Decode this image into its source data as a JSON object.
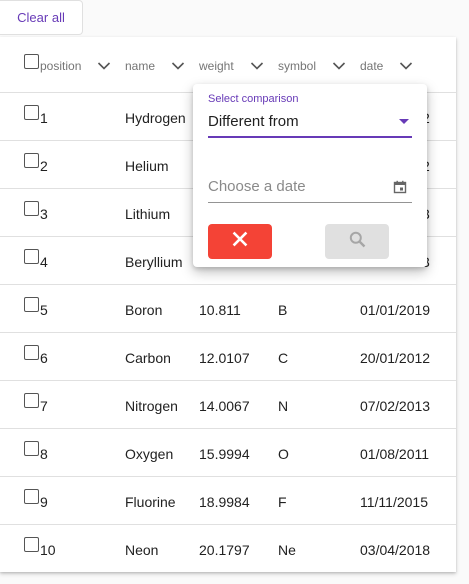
{
  "toolbar": {
    "clear_all_label": "Clear all"
  },
  "table": {
    "columns": [
      {
        "key": "position",
        "label": "position"
      },
      {
        "key": "name",
        "label": "name"
      },
      {
        "key": "weight",
        "label": "weight"
      },
      {
        "key": "symbol",
        "label": "symbol"
      },
      {
        "key": "date",
        "label": "date"
      }
    ],
    "rows": [
      {
        "position": "1",
        "name": "Hydrogen",
        "weight": "",
        "symbol": "",
        "date": "2"
      },
      {
        "position": "2",
        "name": "Helium",
        "weight": "",
        "symbol": "",
        "date": "2"
      },
      {
        "position": "3",
        "name": "Lithium",
        "weight": "",
        "symbol": "",
        "date": "3"
      },
      {
        "position": "4",
        "name": "Beryllium",
        "weight": "",
        "symbol": "",
        "date": "3"
      },
      {
        "position": "5",
        "name": "Boron",
        "weight": "10.811",
        "symbol": "B",
        "date": "01/01/2019"
      },
      {
        "position": "6",
        "name": "Carbon",
        "weight": "12.0107",
        "symbol": "C",
        "date": "20/01/2012"
      },
      {
        "position": "7",
        "name": "Nitrogen",
        "weight": "14.0067",
        "symbol": "N",
        "date": "07/02/2013"
      },
      {
        "position": "8",
        "name": "Oxygen",
        "weight": "15.9994",
        "symbol": "O",
        "date": "01/08/2011"
      },
      {
        "position": "9",
        "name": "Fluorine",
        "weight": "18.9984",
        "symbol": "F",
        "date": "11/11/2015"
      },
      {
        "position": "10",
        "name": "Neon",
        "weight": "20.1797",
        "symbol": "Ne",
        "date": "03/04/2018"
      }
    ]
  },
  "filter_popup": {
    "select_label": "Select comparison",
    "select_value": "Different from",
    "date_placeholder": "Choose a date",
    "icons": {
      "calendar": "calendar-icon",
      "cancel": "close-icon",
      "search": "search-icon"
    }
  },
  "colors": {
    "accent": "#673ab7",
    "danger": "#f44336",
    "disabled": "#e0e0e0"
  }
}
